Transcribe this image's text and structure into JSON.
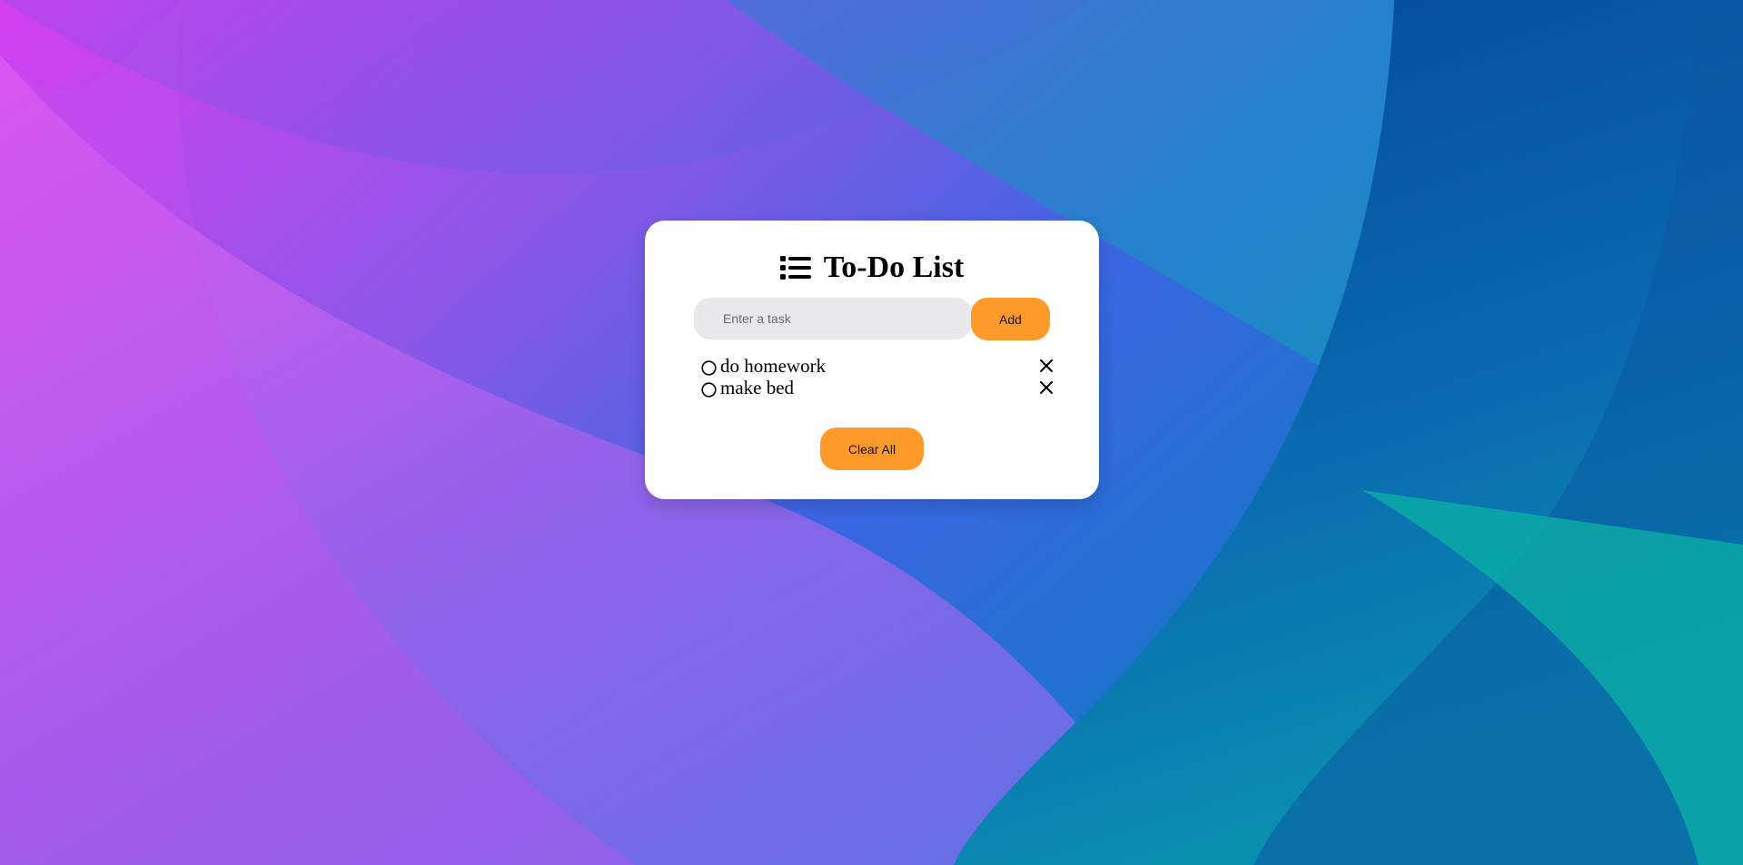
{
  "app": {
    "title": "To-Do List",
    "title_icon": "list-icon"
  },
  "input": {
    "placeholder": "Enter a task",
    "value": ""
  },
  "buttons": {
    "add_label": "Add",
    "clear_label": "Clear All"
  },
  "tasks": [
    {
      "text": "do homework",
      "completed": false,
      "status_icon": "circle-icon",
      "delete_icon": "x-icon"
    },
    {
      "text": "make bed",
      "completed": false,
      "status_icon": "circle-icon",
      "delete_icon": "x-icon"
    }
  ],
  "colors": {
    "accent": "#fd9a2a",
    "input_bg": "#e9e9eb",
    "card_bg": "#ffffff",
    "bg_magenta": "#d94af0",
    "bg_violet": "#7a55e6",
    "bg_blue": "#2f6ee0",
    "bg_navy": "#0b4ca0",
    "bg_teal": "#0fb4a8"
  }
}
